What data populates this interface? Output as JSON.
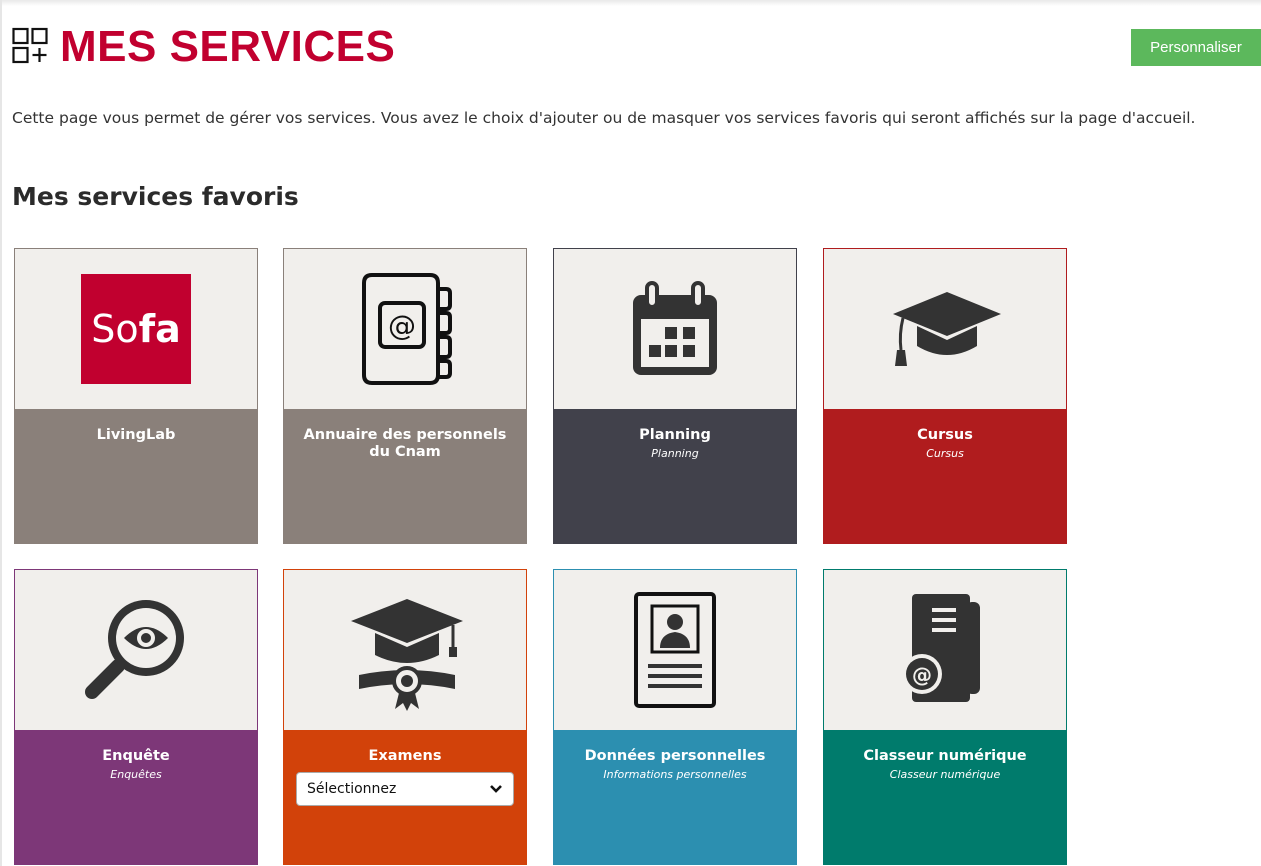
{
  "page": {
    "title": "MES SERVICES",
    "customize_label": "Personnaliser",
    "intro": "Cette page vous permet de gérer vos services. Vous avez le choix d'ajouter ou de masquer vos services favoris qui seront affichés sur la page d'accueil.",
    "section_title": "Mes services favoris"
  },
  "colors": {
    "title_red": "#c1002f",
    "button_green": "#5cb85c",
    "tile_top_bg": "#f1efec",
    "icon_dark": "#333333"
  },
  "tiles": [
    {
      "name": "LivingLab",
      "subtitle": "",
      "icon": "sofa-logo",
      "logo_text_light": "So",
      "logo_text_bold": "fa",
      "color": "#8a807a",
      "border": "#8a807a"
    },
    {
      "name": "Annuaire des personnels du Cnam",
      "subtitle": "",
      "icon": "address-book-icon",
      "color": "#8a807a",
      "border": "#8a807a"
    },
    {
      "name": "Planning",
      "subtitle": "Planning",
      "icon": "calendar-icon",
      "color": "#41414b",
      "border": "#41414b"
    },
    {
      "name": "Cursus",
      "subtitle": "Cursus",
      "icon": "graduation-cap-icon",
      "color": "#b01c1e",
      "border": "#b01c1e"
    },
    {
      "name": "Enquête",
      "subtitle": "Enquêtes",
      "icon": "magnifier-eye-icon",
      "color": "#7d3778",
      "border": "#7d3778"
    },
    {
      "name": "Examens",
      "subtitle": "",
      "icon": "diploma-cap-icon",
      "color": "#d2420a",
      "border": "#d2420a",
      "select_value": "Sélectionnez"
    },
    {
      "name": "Données personnelles",
      "subtitle": "Informations personnelles",
      "icon": "profile-document-icon",
      "color": "#2c8fb0",
      "border": "#2c8fb0"
    },
    {
      "name": "Classeur numérique",
      "subtitle": "Classeur numérique",
      "icon": "digital-binder-icon",
      "color": "#007b6c",
      "border": "#007b6c"
    }
  ]
}
